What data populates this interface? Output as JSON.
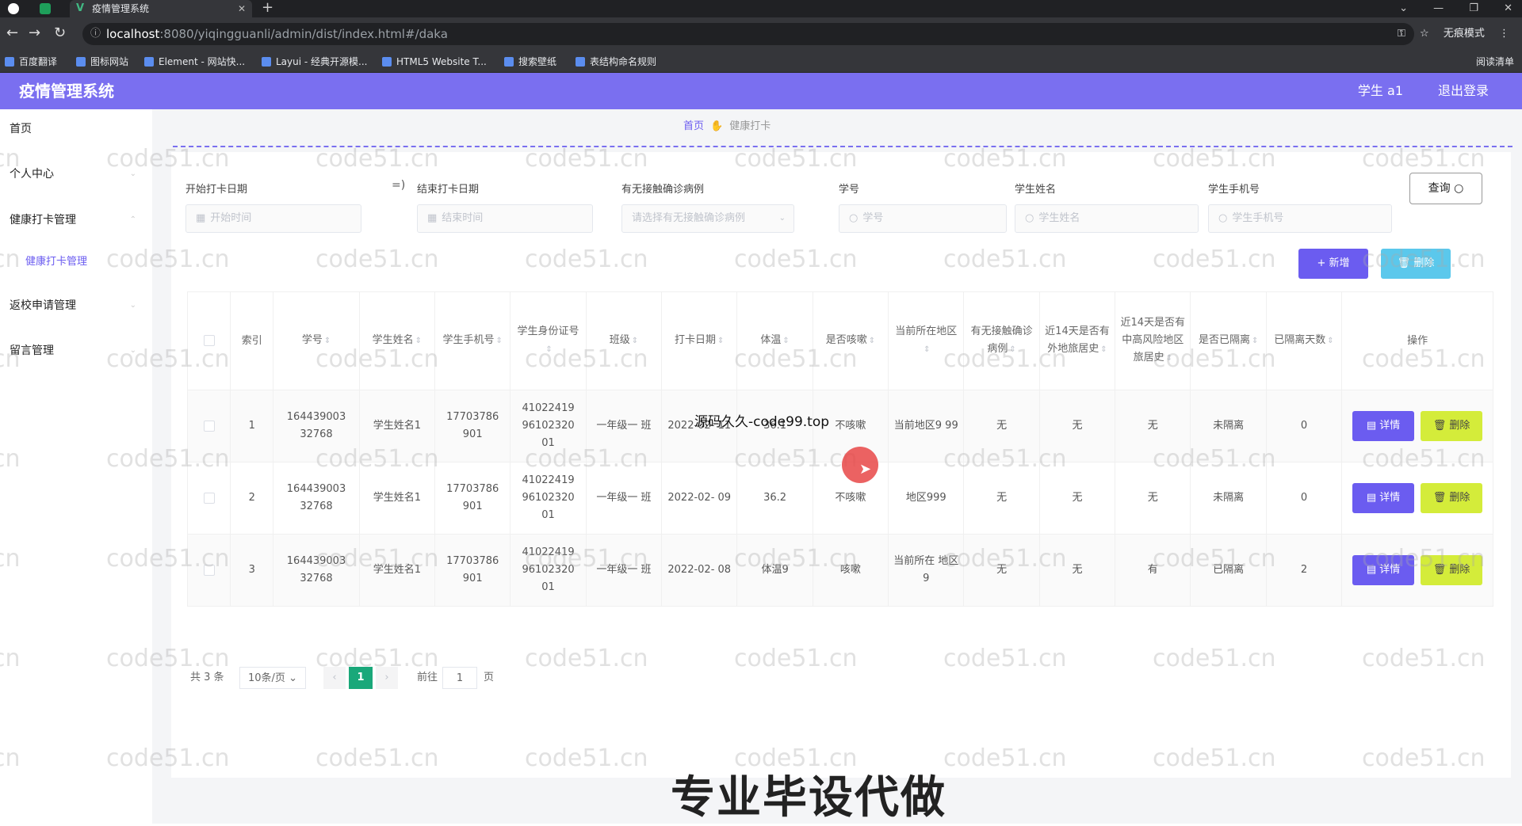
{
  "browser": {
    "tab_title": "疫情管理系统",
    "url_host": "localhost",
    "url_path": ":8080/yiqingguanli/admin/dist/index.html#/daka",
    "incognito_label": "无痕模式",
    "bookmarks": [
      "百度翻译",
      "图标网站",
      "Element - 网站快...",
      "Layui - 经典开源模...",
      "HTML5 Website T...",
      "搜索壁纸",
      "表结构命名规则"
    ],
    "reading_list": "阅读清单"
  },
  "header": {
    "app_title": "疫情管理系统",
    "user_label": "学生 a1",
    "logout_label": "退出登录"
  },
  "sidebar": {
    "items": [
      "首页",
      "个人中心",
      "健康打卡管理",
      "健康打卡管理",
      "返校申请管理",
      "留言管理"
    ]
  },
  "breadcrumb": {
    "home": "首页",
    "current": "健康打卡"
  },
  "filters": {
    "start_date": {
      "label": "开始打卡日期",
      "placeholder": "开始时间"
    },
    "end_date": {
      "label": "结束打卡日期",
      "placeholder": "结束时间"
    },
    "contact": {
      "label": "有无接触确诊病例",
      "placeholder": "请选择有无接触确诊病例"
    },
    "student_no": {
      "label": "学号",
      "placeholder": "学号"
    },
    "student_name": {
      "label": "学生姓名",
      "placeholder": "学生姓名"
    },
    "student_phone": {
      "label": "学生手机号",
      "placeholder": "学生手机号"
    },
    "range_symbol": "=)",
    "query_label": "查询"
  },
  "actions": {
    "add_label": "+ 新增",
    "delete_label": "删除"
  },
  "table": {
    "headers": [
      "索引",
      "学号",
      "学生姓名",
      "学生手机号",
      "学生身份证号",
      "班级",
      "打卡日期",
      "体温",
      "是否咳嗽",
      "当前所在地区",
      "有无接触确诊病例",
      "近14天是否有外地旅居史",
      "近14天是否有中高风险地区旅居史",
      "是否已隔离",
      "已隔离天数",
      "操作"
    ],
    "rows": [
      {
        "idx": "1",
        "sno": "164439003 32768",
        "name": "学生姓名1",
        "phone": "17703786 901",
        "idcard": "41022419 96102320 01",
        "cls": "一年级一 班",
        "date": "2022-02- 11",
        "temp": "36.1",
        "cough": "不咳嗽",
        "region": "当前地区9 99",
        "contact": "无",
        "travel14": "无",
        "risk14": "无",
        "isolated": "未隔离",
        "days": "0"
      },
      {
        "idx": "2",
        "sno": "164439003 32768",
        "name": "学生姓名1",
        "phone": "17703786 901",
        "idcard": "41022419 96102320 01",
        "cls": "一年级一 班",
        "date": "2022-02- 09",
        "temp": "36.2",
        "cough": "不咳嗽",
        "region": "地区999",
        "contact": "无",
        "travel14": "无",
        "risk14": "无",
        "isolated": "未隔离",
        "days": "0"
      },
      {
        "idx": "3",
        "sno": "164439003 32768",
        "name": "学生姓名1",
        "phone": "17703786 901",
        "idcard": "41022419 96102320 01",
        "cls": "一年级一 班",
        "date": "2022-02- 08",
        "temp": "体温9",
        "cough": "咳嗽",
        "region": "当前所在 地区9",
        "contact": "无",
        "travel14": "无",
        "risk14": "有",
        "isolated": "已隔离",
        "days": "2"
      }
    ],
    "detail_label": "详情",
    "delete_label": "删除"
  },
  "pagination": {
    "total": "共 3 条",
    "page_size": "10条/页",
    "current_page": "1",
    "goto_prefix": "前往",
    "goto_value": "1",
    "goto_suffix": "页"
  },
  "overlays": {
    "watermark": "code51.cn",
    "source_text": "源码久久-code99.top",
    "caption": "专业毕设代做"
  },
  "colors": {
    "header_bg": "#7a6ff0",
    "primary": "#6b5cf0",
    "danger_btn": "#d4ec3a",
    "delete_all_btn": "#5bc8ec",
    "active_page": "#1aa87a"
  }
}
